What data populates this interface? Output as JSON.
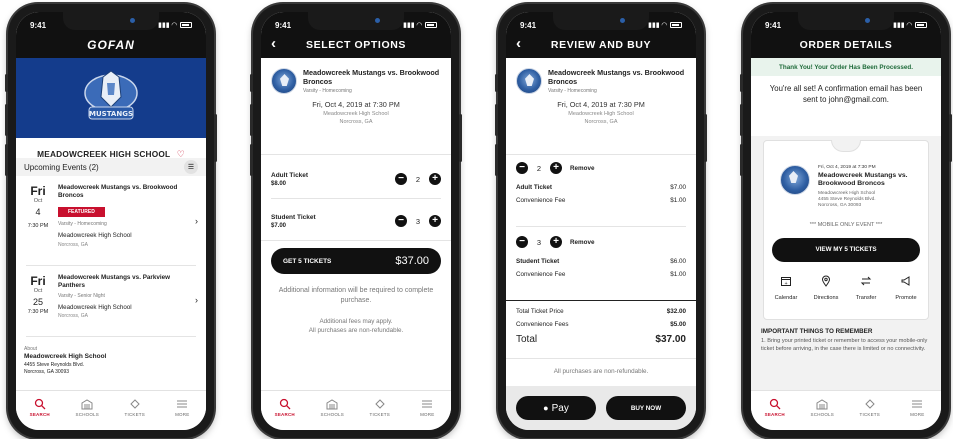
{
  "status_time": "9:41",
  "colors": {
    "brand_red": "#c8102e",
    "navy": "#143c8c",
    "banner_green": "#e8f3ec",
    "black": "#111111"
  },
  "tabbar": [
    {
      "label": "SEARCH",
      "icon": "search-icon",
      "active": true
    },
    {
      "label": "SCHOOLS",
      "icon": "school-icon",
      "active": false
    },
    {
      "label": "TICKETS",
      "icon": "ticket-icon",
      "active": false
    },
    {
      "label": "MORE",
      "icon": "menu-icon",
      "active": false
    }
  ],
  "screen1": {
    "logo": "GOFAN",
    "school_name": "MEADOWCREEK HIGH SCHOOL",
    "upcoming_label": "Upcoming Events (2)",
    "events": [
      {
        "day": "Fri",
        "month": "Oct",
        "date": "4",
        "time": "7:30 PM",
        "title": "Meadowcreek Mustangs vs. Brookwood Broncos",
        "badge": "FEATURED",
        "level": "Varsity - Homecoming",
        "venue": "Meadowcreek High School",
        "city": "Norcross, GA"
      },
      {
        "day": "Fri",
        "month": "Oct",
        "date": "25",
        "time": "7:30 PM",
        "title": "Meadowcreek Mustangs vs. Parkview Panthers",
        "badge": "",
        "level": "Varsity - Senior Night",
        "venue": "Meadowcreek High School",
        "city": "Norcross, GA"
      }
    ],
    "about_label": "About",
    "about_name": "Meadowcreek High School",
    "about_address1": "4455 Steve Reynolds Blvd.",
    "about_address2": "Norcross, GA 30093"
  },
  "screen2": {
    "title": "SELECT OPTIONS",
    "event_title": "Meadowcreek Mustangs vs. Brookwood Broncos",
    "event_level": "Varsity - Homecoming",
    "event_date": "Fri, Oct 4, 2019 at 7:30 PM",
    "event_venue": "Meadowcreek High School",
    "event_city": "Norcross, GA",
    "tickets": [
      {
        "name": "Adult Ticket",
        "price": "$8.00",
        "qty": "2"
      },
      {
        "name": "Student Ticket",
        "price": "$7.00",
        "qty": "3"
      }
    ],
    "cta_label": "GET 5 TICKETS",
    "cta_total": "$37.00",
    "note1": "Additional information will be required to complete purchase.",
    "note2": "Additional fees may apply.",
    "note3": "All purchases are non-refundable."
  },
  "screen3": {
    "title": "REVIEW AND BUY",
    "event_title": "Meadowcreek Mustangs vs. Brookwood Broncos",
    "event_level": "Varsity - Homecoming",
    "event_date": "Fri, Oct 4, 2019 at 7:30 PM",
    "event_venue": "Meadowcreek High School",
    "event_city": "Norcross, GA",
    "remove_label": "Remove",
    "groups": [
      {
        "qty": "2",
        "name": "Adult Ticket",
        "price": "$7.00",
        "fee_label": "Convenience Fee",
        "fee": "$1.00"
      },
      {
        "qty": "3",
        "name": "Student Ticket",
        "price": "$6.00",
        "fee_label": "Convenience Fee",
        "fee": "$1.00"
      }
    ],
    "total_price_label": "Total Ticket Price",
    "total_price": "$32.00",
    "fees_label": "Convenience Fees",
    "fees": "$5.00",
    "total_label": "Total",
    "total": "$37.00",
    "nonrefund": "All purchases are non-refundable.",
    "pay_label": "Pay",
    "buy_label": "BUY NOW"
  },
  "screen4": {
    "title": "ORDER DETAILS",
    "banner": "Thank You! Your Order Has Been Processed.",
    "confirm": "You're all set! A confirmation email has been sent to john@gmail.com.",
    "event_date": "Fri, Oct 4, 2019 at 7:30 PM",
    "event_title": "Meadowcreek Mustangs vs. Brookwood Broncos",
    "event_venue": "Meadowcreek High School",
    "event_address": "4455 Steve Reynolds Blvd.",
    "event_city": "Norcross, GA 30093",
    "mobile_only": "*** MOBILE ONLY EVENT ***",
    "view_btn": "VIEW MY 5 TICKETS",
    "actions": [
      {
        "label": "Calendar",
        "icon": "calendar-icon"
      },
      {
        "label": "Directions",
        "icon": "location-pin-icon"
      },
      {
        "label": "Transfer",
        "icon": "transfer-icon"
      },
      {
        "label": "Promote",
        "icon": "megaphone-icon"
      }
    ],
    "remember_title": "IMPORTANT THINGS TO REMEMBER",
    "remember_item": "1. Bring your printed ticket or remember to access your mobile-only ticket before arriving, in the case there is limited or no connectivity."
  }
}
